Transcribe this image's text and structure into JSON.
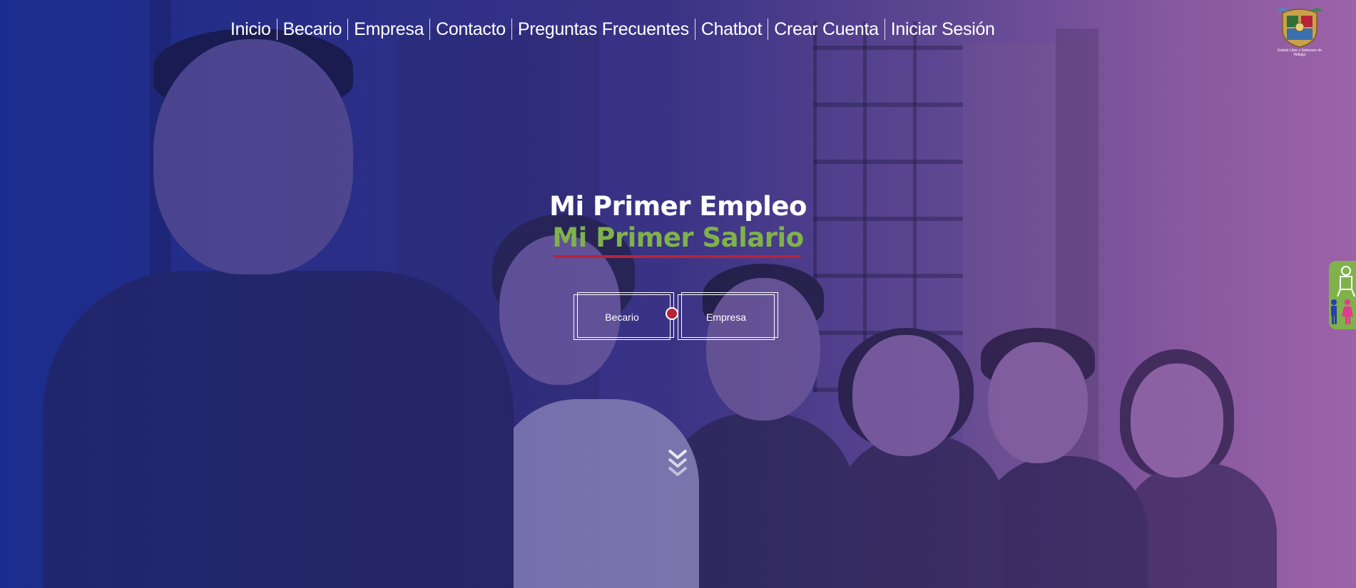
{
  "nav": {
    "items": [
      {
        "label": "Inicio"
      },
      {
        "label": "Becario"
      },
      {
        "label": "Empresa"
      },
      {
        "label": "Contacto"
      },
      {
        "label": "Preguntas Frecuentes"
      },
      {
        "label": "Chatbot"
      },
      {
        "label": "Crear Cuenta"
      },
      {
        "label": "Iniciar Sesión"
      }
    ]
  },
  "logo": {
    "caption": "Estado Libre y Soberano de Hidalgo",
    "icon": "state-coat-of-arms-icon"
  },
  "hero": {
    "title_line1": "Mi Primer Empleo",
    "title_line2": "Mi Primer Salario",
    "buttons": {
      "becario": "Becario",
      "empresa": "Empresa"
    },
    "scroll_icon": "double-chevron-down-icon"
  },
  "accessibility": {
    "icon": "accessibility-icon"
  },
  "colors": {
    "accent_green": "#7fb24a",
    "accent_red": "#b7233a",
    "text": "#ffffff"
  }
}
